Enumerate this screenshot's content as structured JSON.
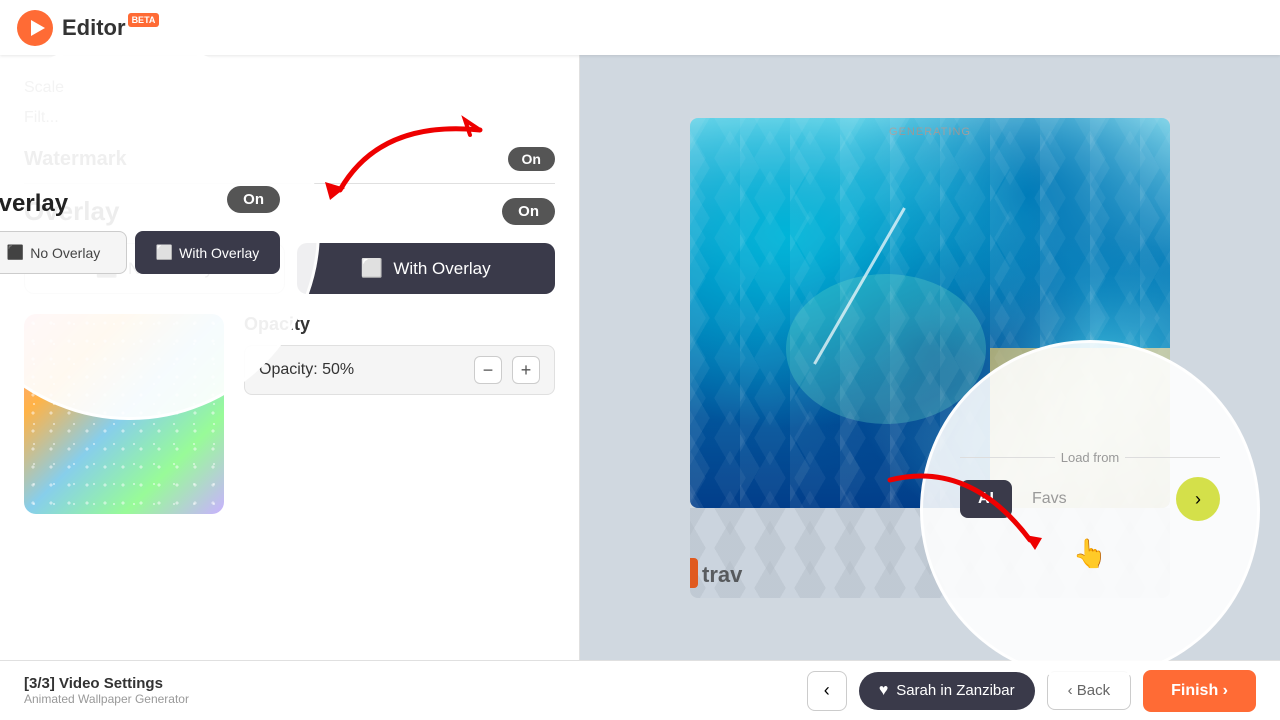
{
  "app": {
    "name": "Editor",
    "beta": "BETA"
  },
  "header": {
    "nav": {
      "scale": "Scale",
      "filter": "Filt..."
    }
  },
  "watermark": {
    "label": "Watermark",
    "toggle": "On"
  },
  "overlay": {
    "title": "Overlay",
    "toggle": "On",
    "no_overlay_label": "No Overlay",
    "with_overlay_label": "With Overlay",
    "opacity_label": "Opacity",
    "opacity_value": "Opacity: 50%",
    "minus_label": "−",
    "plus_label": "+"
  },
  "preview": {
    "generating": "GENERATING"
  },
  "load_from": {
    "label": "Load from",
    "ai_label": "AI",
    "favs_label": "Favs",
    "next_icon": "›"
  },
  "bottom_bar": {
    "step": "[3/3] Video Settings",
    "subtitle": "Animated Wallpaper Generator",
    "prev_icon": "‹",
    "caption_label": "Sarah in Zanzibar",
    "back_label": "‹ Back",
    "finish_label": "Finish ›"
  }
}
